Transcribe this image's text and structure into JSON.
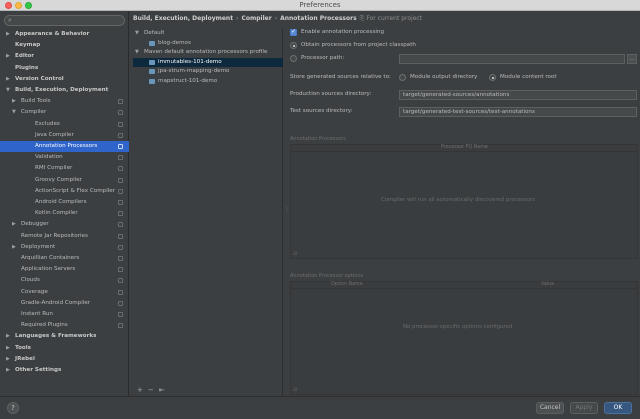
{
  "window": {
    "title": "Preferences"
  },
  "search": {
    "placeholder": ""
  },
  "sidebar": {
    "items": [
      {
        "label": "Appearance & Behavior",
        "arrow": "▶",
        "bold": true
      },
      {
        "label": "Keymap",
        "arrow": "",
        "bold": true
      },
      {
        "label": "Editor",
        "arrow": "▶",
        "bold": true
      },
      {
        "label": "Plugins",
        "arrow": "",
        "bold": true
      },
      {
        "label": "Version Control",
        "arrow": "▶",
        "bold": true
      },
      {
        "label": "Build, Execution, Deployment",
        "arrow": "▼",
        "bold": true
      },
      {
        "label": "Build Tools",
        "arrow": "▶"
      },
      {
        "label": "Compiler",
        "arrow": "▼"
      },
      {
        "label": "Excludes",
        "arrow": ""
      },
      {
        "label": "Java Compiler",
        "arrow": ""
      },
      {
        "label": "Annotation Processors",
        "arrow": "",
        "selected": true
      },
      {
        "label": "Validation",
        "arrow": ""
      },
      {
        "label": "RMI Compiler",
        "arrow": ""
      },
      {
        "label": "Groovy Compiler",
        "arrow": ""
      },
      {
        "label": "ActionScript & Flex Compiler",
        "arrow": ""
      },
      {
        "label": "Android Compilers",
        "arrow": ""
      },
      {
        "label": "Kotlin Compiler",
        "arrow": ""
      },
      {
        "label": "Debugger",
        "arrow": "▶"
      },
      {
        "label": "Remote Jar Repositories",
        "arrow": ""
      },
      {
        "label": "Deployment",
        "arrow": "▶"
      },
      {
        "label": "Arquillian Containers",
        "arrow": ""
      },
      {
        "label": "Application Servers",
        "arrow": ""
      },
      {
        "label": "Clouds",
        "arrow": ""
      },
      {
        "label": "Coverage",
        "arrow": ""
      },
      {
        "label": "Gradle-Android Compiler",
        "arrow": ""
      },
      {
        "label": "Instant Run",
        "arrow": ""
      },
      {
        "label": "Required Plugins",
        "arrow": ""
      },
      {
        "label": "Languages & Frameworks",
        "arrow": "▶",
        "bold": true
      },
      {
        "label": "Tools",
        "arrow": "▶",
        "bold": true
      },
      {
        "label": "JRebel",
        "arrow": "▶",
        "bold": true
      },
      {
        "label": "Other Settings",
        "arrow": "▶",
        "bold": true
      }
    ]
  },
  "breadcrumb": {
    "parts": [
      "Build, Execution, Deployment",
      "Compiler",
      "Annotation Processors"
    ],
    "separator": "›",
    "note": "For current project"
  },
  "profiles": {
    "items": [
      {
        "label": "Default",
        "arrow": "▼",
        "module": false
      },
      {
        "label": "blog-demos",
        "arrow": "",
        "module": true
      },
      {
        "label": "Maven default annotation processors profile",
        "arrow": "▼",
        "module": false
      },
      {
        "label": "immutables-101-demo",
        "arrow": "",
        "module": true,
        "selected": true
      },
      {
        "label": "jpa-strum-mapping-demo",
        "arrow": "",
        "module": true
      },
      {
        "label": "mapstruct-101-demo",
        "arrow": "",
        "module": true
      }
    ],
    "tools": [
      "+",
      "−",
      "⇤"
    ]
  },
  "settings": {
    "enable_label": "Enable annotation processing",
    "obtain_label": "Obtain processors from project classpath",
    "processor_path_label": "Processor path:",
    "processor_path_value": "",
    "store_label": "Store generated sources relative to:",
    "module_output_label": "Module output directory",
    "module_content_label": "Module content root",
    "production_label": "Production sources directory:",
    "production_value": "target/generated-sources/annotations",
    "test_label": "Test sources directory:",
    "test_value": "target/generated-test-sources/test-annotations"
  },
  "processors_panel": {
    "title": "Annotation Processors",
    "column": "Processor FQ Name",
    "empty": "Compiler will run all automatically discovered processors"
  },
  "options_panel": {
    "title": "Annotation Processor options",
    "col_name": "Option Name",
    "col_value": "Value",
    "empty": "No processor-specific options configured"
  },
  "footer": {
    "help": "?",
    "cancel": "Cancel",
    "apply": "Apply",
    "ok": "OK"
  }
}
